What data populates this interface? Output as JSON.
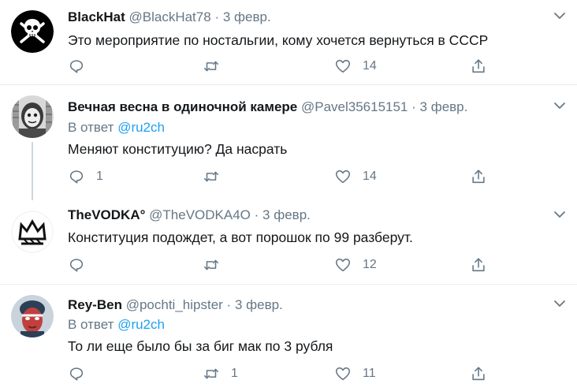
{
  "tweets": [
    {
      "name": "BlackHat",
      "handle": "@BlackHat78",
      "date": "3 февр.",
      "reply_label": "",
      "reply_mention": "",
      "text": "Это мероприятие по ностальгии, кому хочется вернуться в СССР",
      "replies": "",
      "retweets": "",
      "likes": "14",
      "avatar_icon": "pirate-skull-avatar"
    },
    {
      "name": "Вечная весна в одиночной камере",
      "handle": "@Pavel35615151",
      "date": "3 февр.",
      "reply_label": "В ответ",
      "reply_mention": "@ru2ch",
      "text": "Меняют конституцию? Да насрать",
      "replies": "1",
      "retweets": "",
      "likes": "14",
      "avatar_icon": "masked-face-avatar"
    },
    {
      "name": "TheVODKA°",
      "handle": "@TheVODKA4O",
      "date": "3 февр.",
      "reply_label": "",
      "reply_mention": "",
      "text": "Конституция подождет, а вот порошок по 99 разберут.",
      "replies": "",
      "retweets": "",
      "likes": "12",
      "avatar_icon": "crown-avatar"
    },
    {
      "name": "Rey-Ben",
      "handle": "@pochti_hipster",
      "date": "3 февр.",
      "reply_label": "В ответ",
      "reply_mention": "@ru2ch",
      "text": "То ли еще было бы за биг мак по 3 рубля",
      "replies": "",
      "retweets": "1",
      "likes": "11",
      "avatar_icon": "painted-face-avatar"
    }
  ],
  "separator": "·",
  "colors": {
    "text": "#14171a",
    "muted": "#657786",
    "link": "#1da1f2",
    "divider": "#e6ecf0"
  }
}
